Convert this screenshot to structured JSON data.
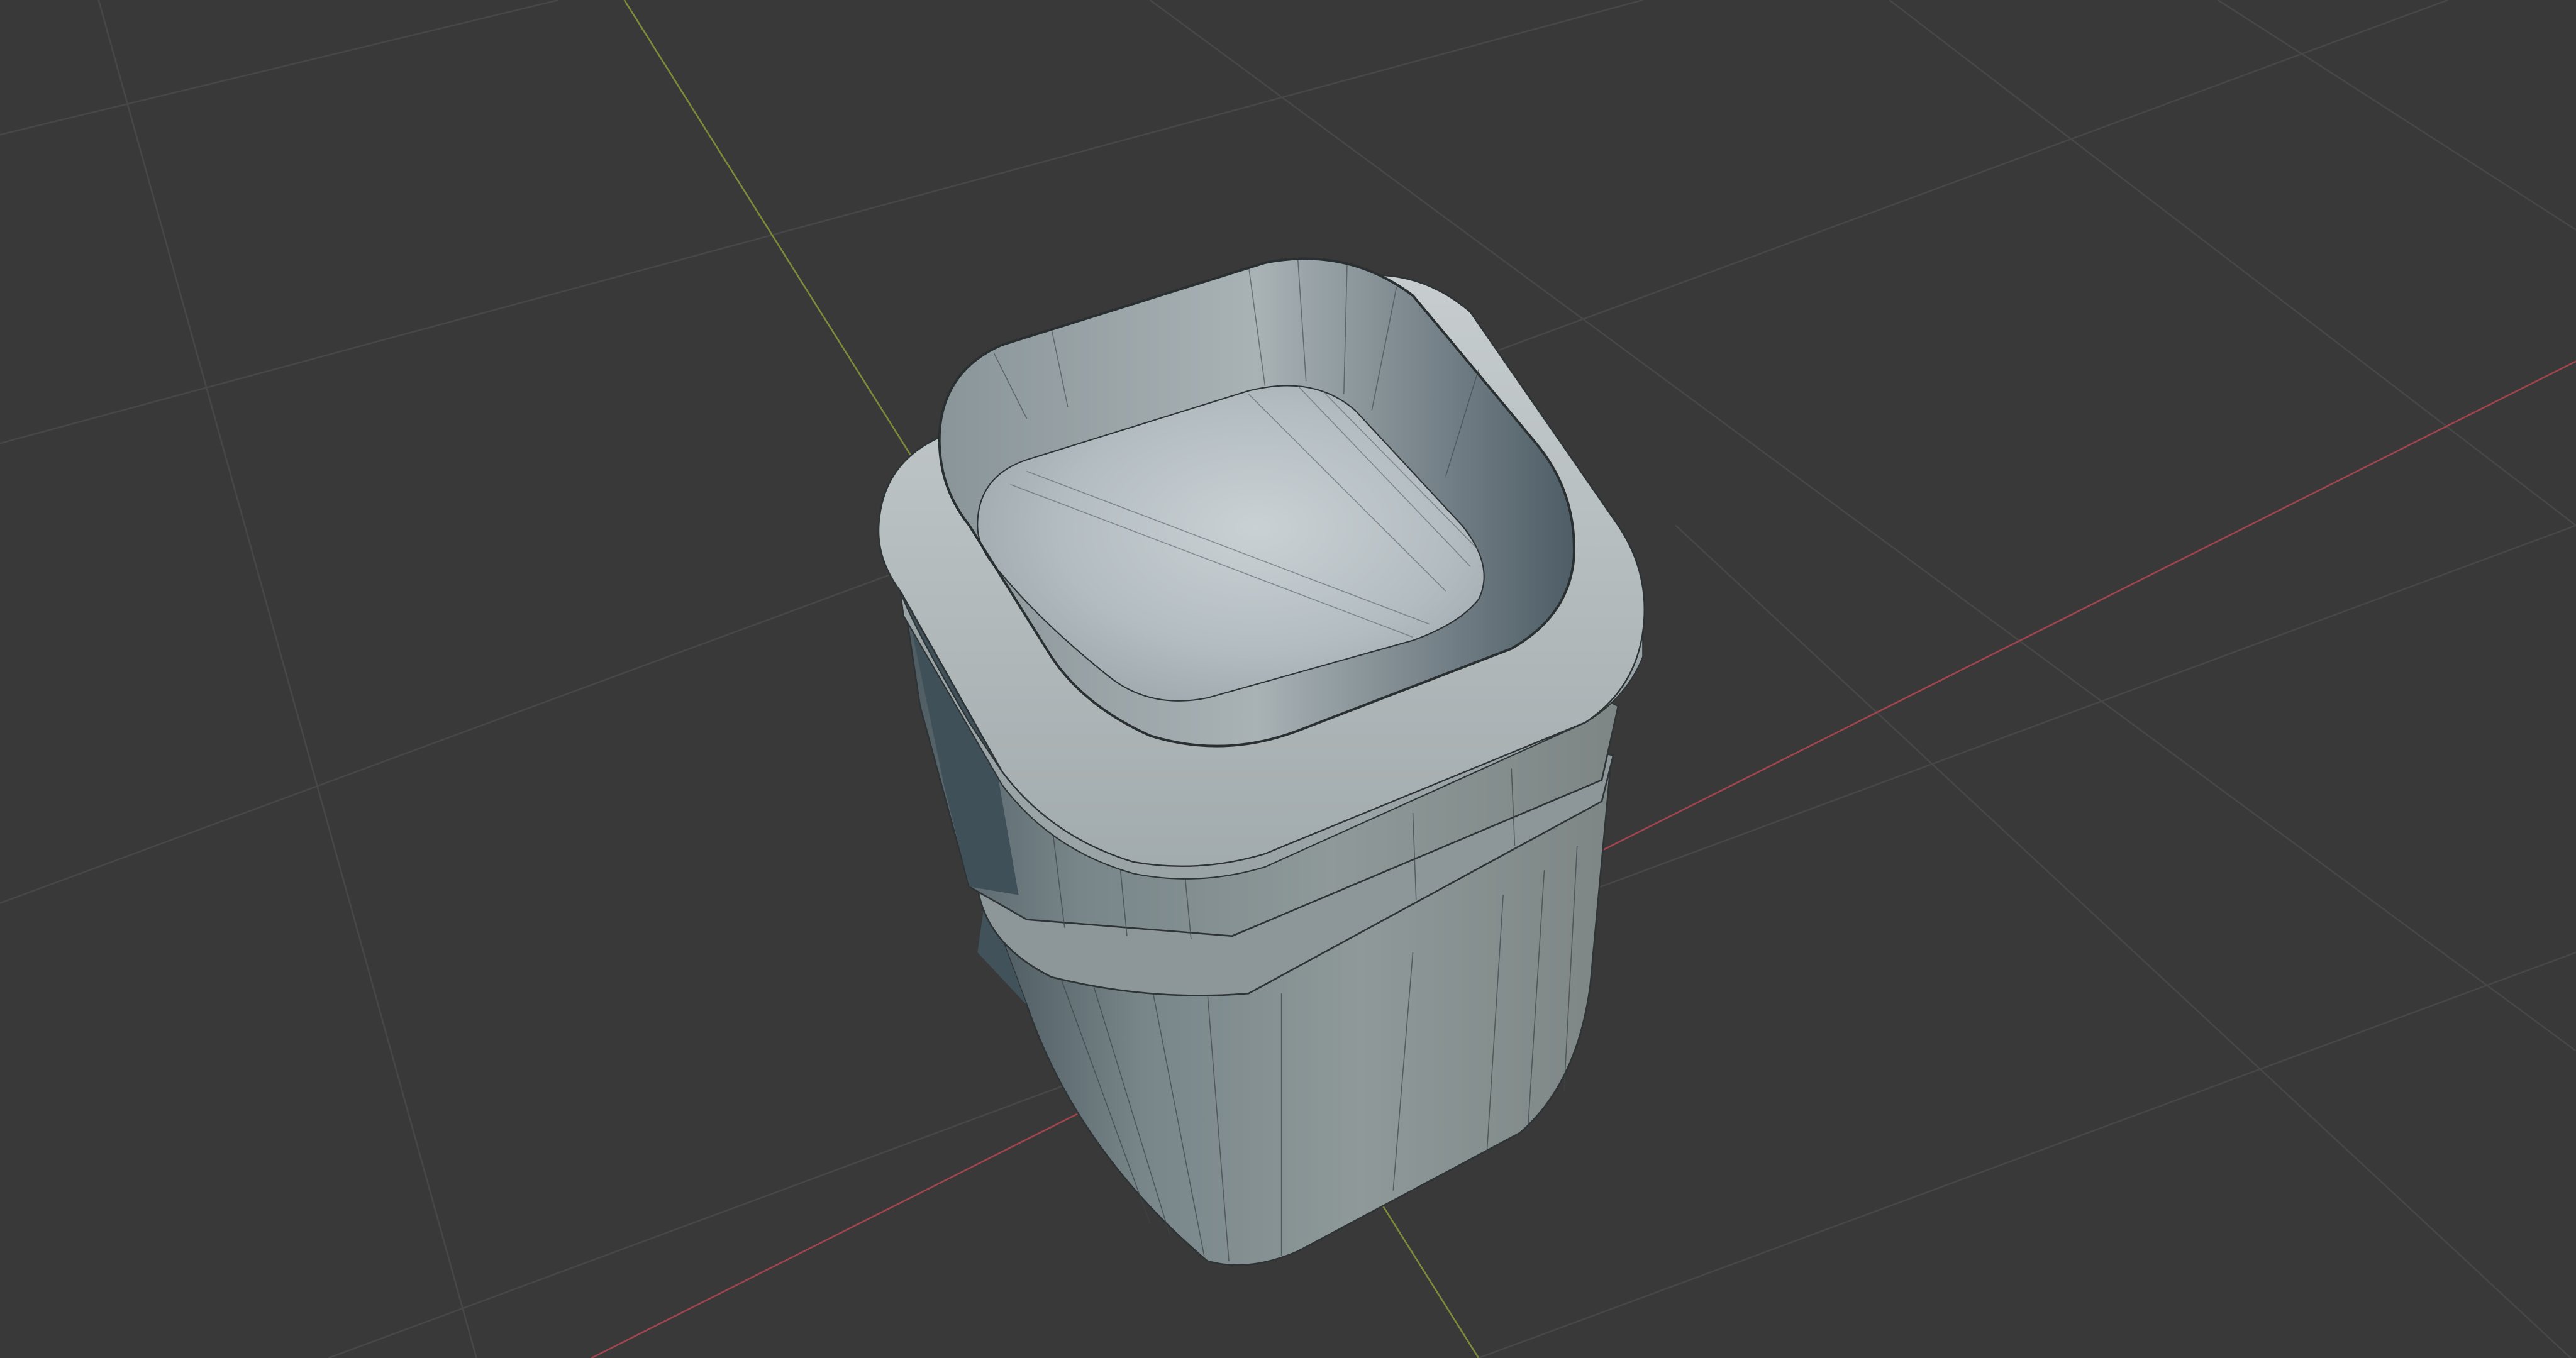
{
  "viewport": {
    "mode": "3d-viewport",
    "background_color": "#393939",
    "grid_color": "#4a4a4a",
    "x_axis_color": "#b5424c",
    "y_axis_color": "#8ca235",
    "object": {
      "name": "mesh-jar",
      "body_color": "#8e9898",
      "top_color": "#c7ced1",
      "shadow_color": "#3d4a52",
      "wire_color": "#2e3335"
    }
  }
}
